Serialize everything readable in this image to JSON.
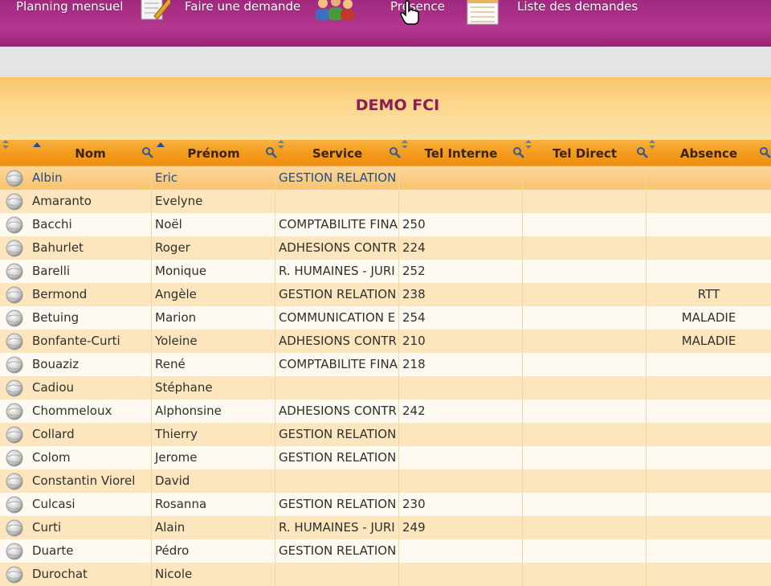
{
  "nav": {
    "items": [
      {
        "label": "Planning mensuel",
        "icon": "calendar-icon"
      },
      {
        "label": "Faire une demande",
        "icon": "form-pen-icon"
      },
      {
        "label": "Présence",
        "icon": "people-icon"
      },
      {
        "label": "Liste des demandes",
        "icon": "list-icon"
      }
    ]
  },
  "page": {
    "title": "DEMO FCI"
  },
  "table": {
    "columns": {
      "nom": "Nom",
      "prenom": "Prénom",
      "service": "Service",
      "tel_interne": "Tel Interne",
      "tel_direct": "Tel Direct",
      "absence": "Absence"
    },
    "rows": [
      {
        "nom": "Albin",
        "prenom": "Eric",
        "service": "GESTION RELATION",
        "tel_interne": "",
        "tel_direct": "",
        "absence": ""
      },
      {
        "nom": "Amaranto",
        "prenom": "Evelyne",
        "service": "",
        "tel_interne": "",
        "tel_direct": "",
        "absence": ""
      },
      {
        "nom": "Bacchi",
        "prenom": "Noël",
        "service": "COMPTABILITE FINA",
        "tel_interne": "250",
        "tel_direct": "",
        "absence": ""
      },
      {
        "nom": "Bahurlet",
        "prenom": "Roger",
        "service": "ADHESIONS CONTR",
        "tel_interne": "224",
        "tel_direct": "",
        "absence": ""
      },
      {
        "nom": "Barelli",
        "prenom": "Monique",
        "service": "R. HUMAINES - JURI",
        "tel_interne": "252",
        "tel_direct": "",
        "absence": ""
      },
      {
        "nom": "Bermond",
        "prenom": "Angèle",
        "service": "GESTION RELATION",
        "tel_interne": "238",
        "tel_direct": "",
        "absence": "RTT"
      },
      {
        "nom": "Betuing",
        "prenom": "Marion",
        "service": "COMMUNICATION E",
        "tel_interne": "254",
        "tel_direct": "",
        "absence": "MALADIE"
      },
      {
        "nom": "Bonfante-Curti",
        "prenom": "Yoleine",
        "service": "ADHESIONS CONTR",
        "tel_interne": "210",
        "tel_direct": "",
        "absence": "MALADIE"
      },
      {
        "nom": "Bouaziz",
        "prenom": "René",
        "service": "COMPTABILITE FINA",
        "tel_interne": "218",
        "tel_direct": "",
        "absence": ""
      },
      {
        "nom": "Cadiou",
        "prenom": "Stéphane",
        "service": "",
        "tel_interne": "",
        "tel_direct": "",
        "absence": ""
      },
      {
        "nom": "Chommeloux",
        "prenom": "Alphonsine",
        "service": "ADHESIONS CONTR",
        "tel_interne": "242",
        "tel_direct": "",
        "absence": ""
      },
      {
        "nom": "Collard",
        "prenom": "Thierry",
        "service": "GESTION RELATION",
        "tel_interne": "",
        "tel_direct": "",
        "absence": ""
      },
      {
        "nom": "Colom",
        "prenom": "Jerome",
        "service": "GESTION RELATION",
        "tel_interne": "",
        "tel_direct": "",
        "absence": ""
      },
      {
        "nom": "Constantin Viorel",
        "prenom": "David",
        "service": "",
        "tel_interne": "",
        "tel_direct": "",
        "absence": ""
      },
      {
        "nom": "Culcasi",
        "prenom": "Rosanna",
        "service": "GESTION RELATION",
        "tel_interne": "230",
        "tel_direct": "",
        "absence": ""
      },
      {
        "nom": "Curti",
        "prenom": "Alain",
        "service": "R. HUMAINES - JURI",
        "tel_interne": "249",
        "tel_direct": "",
        "absence": ""
      },
      {
        "nom": "Duarte",
        "prenom": "Pédro",
        "service": "GESTION RELATION",
        "tel_interne": "",
        "tel_direct": "",
        "absence": ""
      },
      {
        "nom": "Durochat",
        "prenom": "Nicole",
        "service": "",
        "tel_interne": "",
        "tel_direct": "",
        "absence": ""
      }
    ],
    "selected_row": 0
  },
  "colors": {
    "nav_bg": "#a52c82",
    "title_text": "#8c1d55",
    "header_orange": "#f39a1b",
    "row_odd": "#fde6bd",
    "row_even": "#fffaf1"
  }
}
